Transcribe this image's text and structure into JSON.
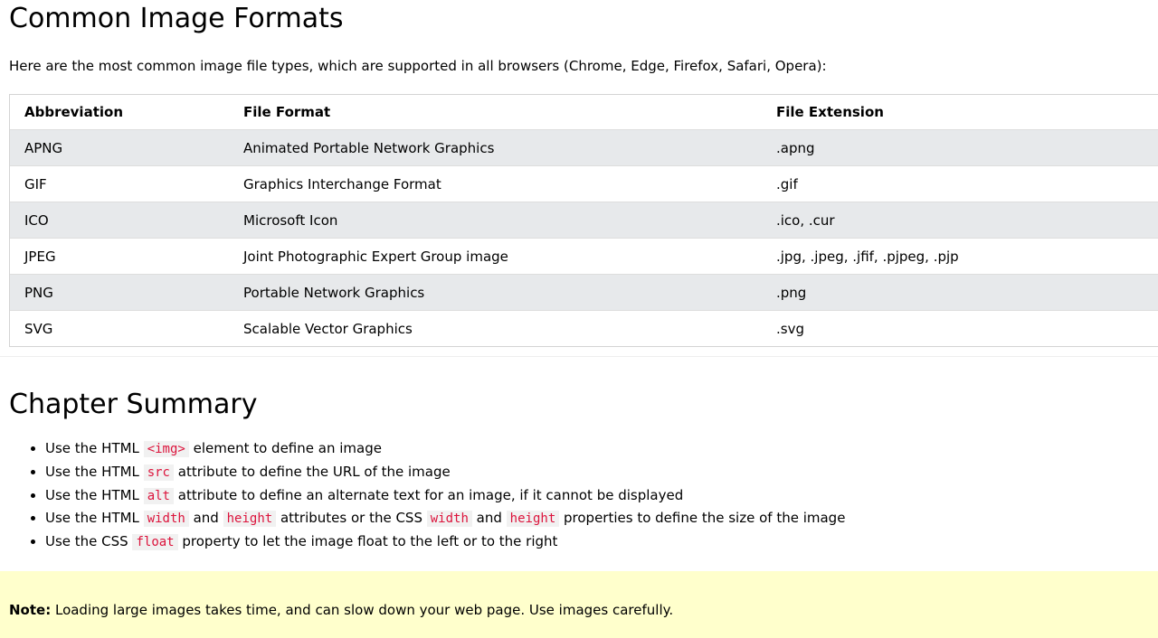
{
  "formats_section": {
    "title": "Common Image Formats",
    "intro": "Here are the most common image file types, which are supported in all browsers (Chrome, Edge, Firefox, Safari, Opera):",
    "headers": [
      "Abbreviation",
      "File Format",
      "File Extension"
    ],
    "rows": [
      [
        "APNG",
        "Animated Portable Network Graphics",
        ".apng"
      ],
      [
        "GIF",
        "Graphics Interchange Format",
        ".gif"
      ],
      [
        "ICO",
        "Microsoft Icon",
        ".ico, .cur"
      ],
      [
        "JPEG",
        "Joint Photographic Expert Group image",
        ".jpg, .jpeg, .jfif, .pjpeg, .pjp"
      ],
      [
        "PNG",
        "Portable Network Graphics",
        ".png"
      ],
      [
        "SVG",
        "Scalable Vector Graphics",
        ".svg"
      ]
    ]
  },
  "summary_section": {
    "title": "Chapter Summary",
    "items": [
      [
        {
          "t": "Use the HTML "
        },
        {
          "c": "<img>"
        },
        {
          "t": " element to define an image"
        }
      ],
      [
        {
          "t": "Use the HTML "
        },
        {
          "c": "src"
        },
        {
          "t": " attribute to define the URL of the image"
        }
      ],
      [
        {
          "t": "Use the HTML "
        },
        {
          "c": "alt"
        },
        {
          "t": " attribute to define an alternate text for an image, if it cannot be displayed"
        }
      ],
      [
        {
          "t": "Use the HTML "
        },
        {
          "c": "width"
        },
        {
          "t": " and "
        },
        {
          "c": "height"
        },
        {
          "t": " attributes or the CSS "
        },
        {
          "c": "width"
        },
        {
          "t": " and "
        },
        {
          "c": "height"
        },
        {
          "t": " properties to define the size of the image"
        }
      ],
      [
        {
          "t": "Use the CSS "
        },
        {
          "c": "float"
        },
        {
          "t": " property to let the image float to the left or to the right"
        }
      ]
    ]
  },
  "note": {
    "label": "Note:",
    "text": " Loading large images takes time, and can slow down your web page. Use images carefully."
  },
  "colors": {
    "code_text": "#dc143c",
    "code_bg": "#f1f1f1",
    "stripe": "#e7e9eb",
    "note_bg": "#ffffcc"
  }
}
